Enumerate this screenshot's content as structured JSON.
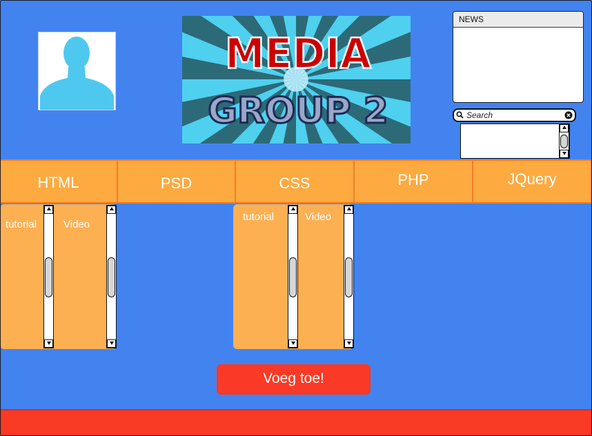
{
  "header": {
    "logo": {
      "line1": "MEDIA",
      "line2": "GROUP 2"
    }
  },
  "news": {
    "title": "NEWS"
  },
  "search": {
    "placeholder": "Search"
  },
  "nav": {
    "tabs": [
      "HTML",
      "PSD",
      "CSS",
      "PHP",
      "JQuery"
    ]
  },
  "panels": {
    "html": {
      "tutorial_label": "tutorial",
      "video_label": "Video"
    },
    "css": {
      "tutorial_label": "tutorial",
      "video_label": "Video"
    }
  },
  "actions": {
    "add_label": "Voeg toe!"
  },
  "colors": {
    "background": "#4283f0",
    "nav_tab": "#fdaa40",
    "nav_border": "#f07d2a",
    "panel": "#fdb052",
    "button": "#fa3a26",
    "footer": "#f93a24"
  },
  "icons": {
    "avatar": "person-silhouette-icon",
    "search": "magnifier-icon",
    "clear": "clear-x-icon"
  }
}
